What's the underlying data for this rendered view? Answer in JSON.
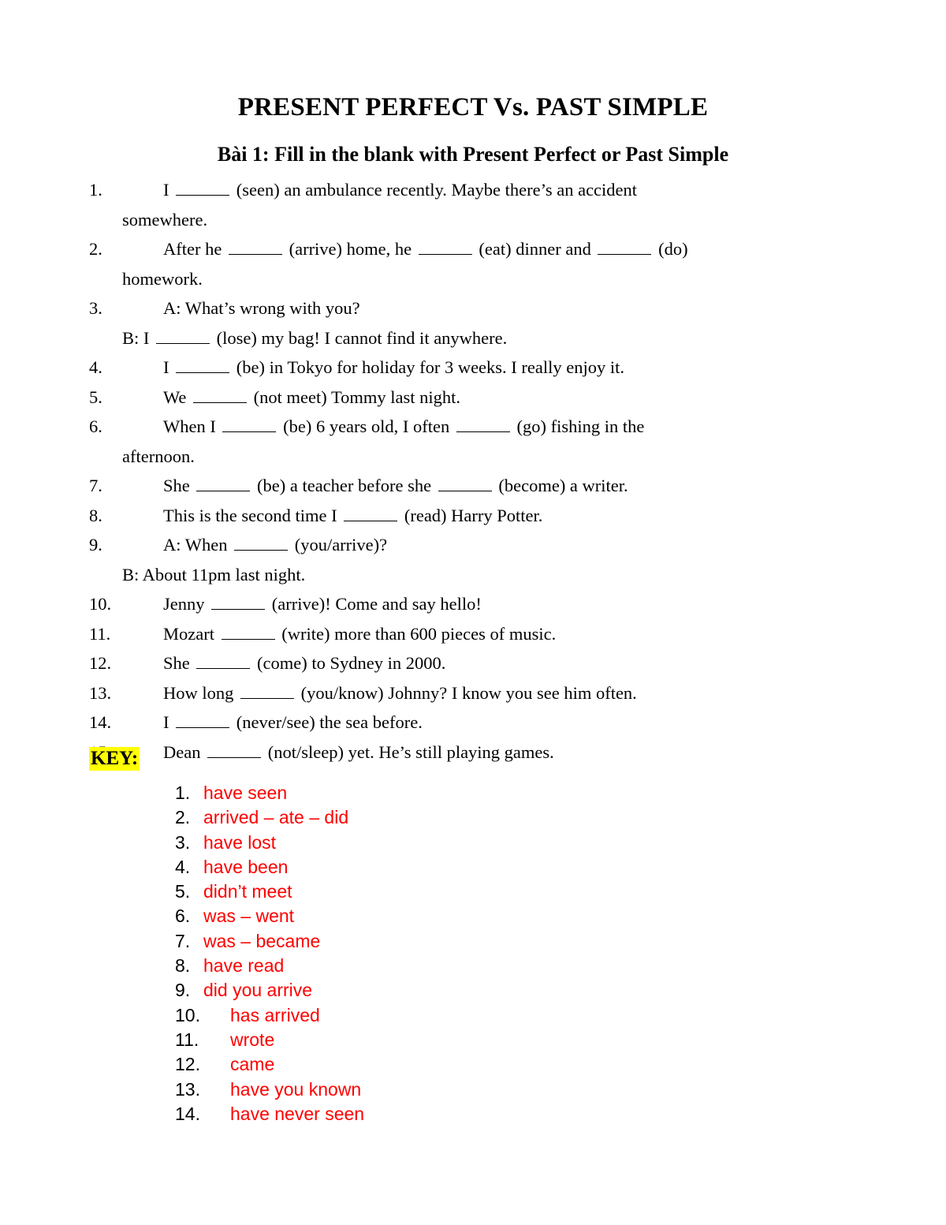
{
  "document": {
    "title": "PRESENT PERFECT Vs. PAST SIMPLE",
    "subtitle": "Bài 1: Fill in the blank with Present Perfect or Past Simple",
    "key_heading": "KEY:",
    "colors": {
      "answer_red": "#ff0000",
      "highlight_yellow": "#ffff00",
      "text_black": "#000000",
      "page_background": "#ffffff"
    }
  },
  "exercise": {
    "items": [
      {
        "number": "1.",
        "line1_a": "I ",
        "line1_b": " (seen) an ambulance recently. Maybe there’s an accident",
        "line2": "somewhere."
      },
      {
        "number": "2.",
        "line1_a": "After he ",
        "line1_b": " (arrive) home, he ",
        "line1_c": " (eat) dinner and ",
        "line1_d": " (do)",
        "line2": "homework."
      },
      {
        "number": "3.",
        "line1": "A: What’s wrong with you?",
        "line2_a": "B: I ",
        "line2_b": " (lose) my bag! I cannot find it anywhere."
      },
      {
        "number": "4.",
        "line1_a": "I ",
        "line1_b": " (be) in Tokyo for holiday for 3 weeks. I really enjoy it."
      },
      {
        "number": "5.",
        "line1_a": "We ",
        "line1_b": " (not meet) Tommy last night."
      },
      {
        "number": "6.",
        "line1_a": "When I ",
        "line1_b": " (be) 6 years old, I often ",
        "line1_c": " (go) fishing in the",
        "line2": "afternoon."
      },
      {
        "number": "7.",
        "line1_a": "She ",
        "line1_b": " (be) a teacher before she ",
        "line1_c": " (become) a writer."
      },
      {
        "number": "8.",
        "line1_a": "This is the second time I ",
        "line1_b": " (read) Harry Potter."
      },
      {
        "number": "9.",
        "line1_a": "A: When ",
        "line1_b": " (you/arrive)?",
        "line2": "B: About 11pm last night."
      },
      {
        "number": "10.",
        "line1_a": "Jenny ",
        "line1_b": " (arrive)! Come and say hello!"
      },
      {
        "number": "11.",
        "line1_a": "Mozart ",
        "line1_b": " (write) more than 600 pieces of music."
      },
      {
        "number": "12.",
        "line1_a": "She ",
        "line1_b": " (come) to Sydney in 2000."
      },
      {
        "number": "13.",
        "line1_a": "How long ",
        "line1_b": " (you/know) Johnny? I know you see him often."
      },
      {
        "number": "14.",
        "line1_a": "I ",
        "line1_b": " (never/see) the sea before."
      },
      {
        "number": "15.",
        "line1_a": "Dean ",
        "line1_b": " (not/sleep) yet. He’s still playing games."
      }
    ]
  },
  "key": {
    "items": [
      {
        "number": "1.",
        "answer": "have seen"
      },
      {
        "number": "2.",
        "answer": "arrived – ate – did"
      },
      {
        "number": "3.",
        "answer": "have lost"
      },
      {
        "number": "4.",
        "answer": "have been"
      },
      {
        "number": "5.",
        "answer": "didn’t meet"
      },
      {
        "number": "6.",
        "answer": "was – went"
      },
      {
        "number": "7.",
        "answer": "was – became"
      },
      {
        "number": "8.",
        "answer": "have read"
      },
      {
        "number": "9.",
        "answer": "did you arrive"
      },
      {
        "number": "10.",
        "answer": "has arrived"
      },
      {
        "number": "11.",
        "answer": "wrote"
      },
      {
        "number": "12.",
        "answer": "came"
      },
      {
        "number": "13.",
        "answer": "have you known"
      },
      {
        "number": "14.",
        "answer": "have never seen"
      }
    ]
  }
}
